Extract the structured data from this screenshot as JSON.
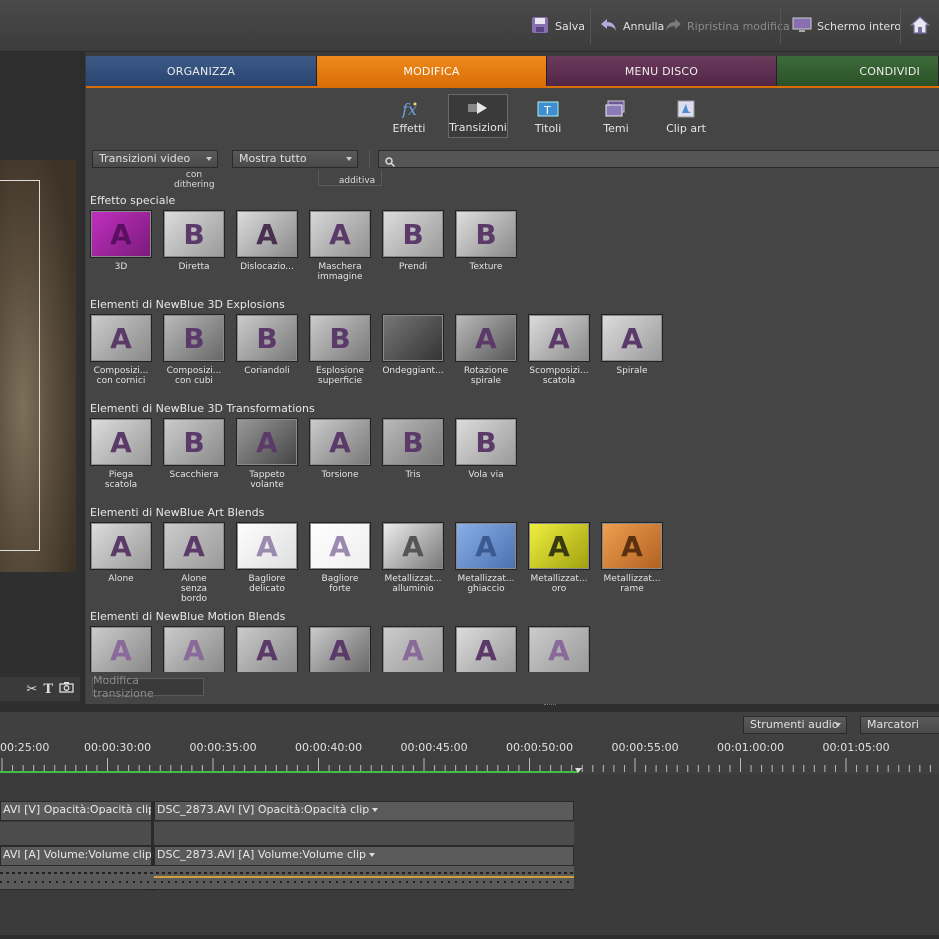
{
  "topbar": {
    "save": "Salva",
    "undo": "Annulla",
    "redo": "Ripristina modifica",
    "fullscreen": "Schermo intero"
  },
  "tabs": {
    "organize": "ORGANIZZA",
    "edit": "MODIFICA",
    "menu": "MENU DISCO",
    "share": "CONDIVIDI"
  },
  "subtabs": {
    "effects": "Effetti",
    "transitions": "Transizioni",
    "titles": "Titoli",
    "themes": "Temi",
    "clipart": "Clip art"
  },
  "filters": {
    "category": "Transizioni video",
    "show": "Mostra tutto"
  },
  "partial_labels": [
    "con\ndithering",
    "additiva"
  ],
  "categories": [
    {
      "title": "Effetto speciale",
      "items": [
        "3D",
        "Diretta",
        "Dislocazio...",
        "Maschera\nimmagine",
        "Prendi",
        "Texture"
      ]
    },
    {
      "title": "Elementi di NewBlue 3D Explosions",
      "items": [
        "Composizi...\ncon cornici",
        "Composizi...\ncon cubi",
        "Coriandoli",
        "Esplosione\nsuperficie",
        "Ondeggiant...",
        "Rotazione\nspirale",
        "Scomposizi...\nscatola",
        "Spirale"
      ]
    },
    {
      "title": "Elementi di NewBlue 3D Transformations",
      "items": [
        "Piega\nscatola",
        "Scacchiera",
        "Tappeto\nvolante",
        "Torsione",
        "Tris",
        "Vola via"
      ]
    },
    {
      "title": "Elementi di NewBlue Art Blends",
      "items": [
        "Alone",
        "Alone\nsenza\nbordo",
        "Bagliore\ndelicato",
        "Bagliore\nforte",
        "Metallizzat...\nalluminio",
        "Metallizzat...\nghiaccio",
        "Metallizzat...\noro",
        "Metallizzat...\nrame"
      ]
    },
    {
      "title": "Elementi di NewBlue Motion Blends",
      "items": [
        "",
        "",
        "",
        "",
        "",
        "",
        ""
      ]
    }
  ],
  "modify_transition": "Modifica transizione",
  "timeline": {
    "audio_tools": "Strumenti audio",
    "markers": "Marcatori",
    "timecodes": [
      "00:25:00",
      "00:00:30:00",
      "00:00:35:00",
      "00:00:40:00",
      "00:00:45:00",
      "00:00:50:00",
      "00:00:55:00",
      "00:01:00:00",
      "00:01:05:00"
    ],
    "video_track_left": "AVI [V]  Opacità:Opacità clip",
    "video_track_right": "DSC_2873.AVI [V]  Opacità:Opacità clip",
    "audio_track_left": "AVI [A]  Volume:Volume clip",
    "audio_track_right": "DSC_2873.AVI [A]  Volume:Volume clip"
  },
  "colors": {
    "accent": "#d96e07",
    "organize": "#2a4470",
    "menu": "#522647",
    "share": "#2b5229",
    "timeline_progress": "#3fbf3f"
  }
}
